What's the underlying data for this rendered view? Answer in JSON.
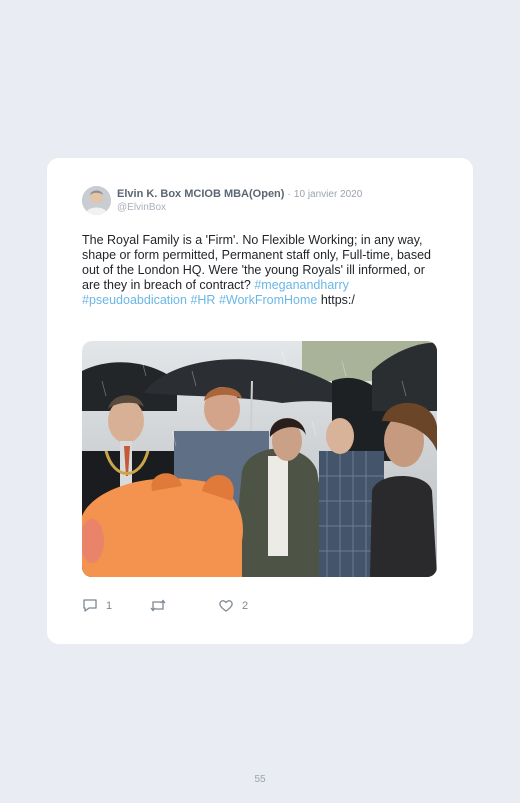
{
  "tweet": {
    "author_name": "Elvin K. Box MCIOB MBA(Open)",
    "separator": "·",
    "date": "10 janvier 2020",
    "handle": "@ElvinBox",
    "text_plain": "The Royal Family is a 'Firm'. No Flexible Working; in any way, shape or form permitted, Permanent staff only, Full-time, based out of the London HQ. Were 'the young Royals' ill informed, or are they in breach of contract?",
    "hashtags": [
      "#meganandharry",
      "#pseudoabdication",
      "#HR",
      "#WorkFromHome"
    ],
    "link_text": "https:/",
    "actions": {
      "reply_icon": "reply-icon",
      "reply_count": "1",
      "retweet_icon": "retweet-icon",
      "like_icon": "heart-icon",
      "like_count": "2"
    }
  },
  "page": {
    "number": "55"
  },
  "colors": {
    "background": "#e9ecf3",
    "card": "#ffffff",
    "hashtag": "#6ab7e6",
    "muted": "#9aa3ad"
  }
}
